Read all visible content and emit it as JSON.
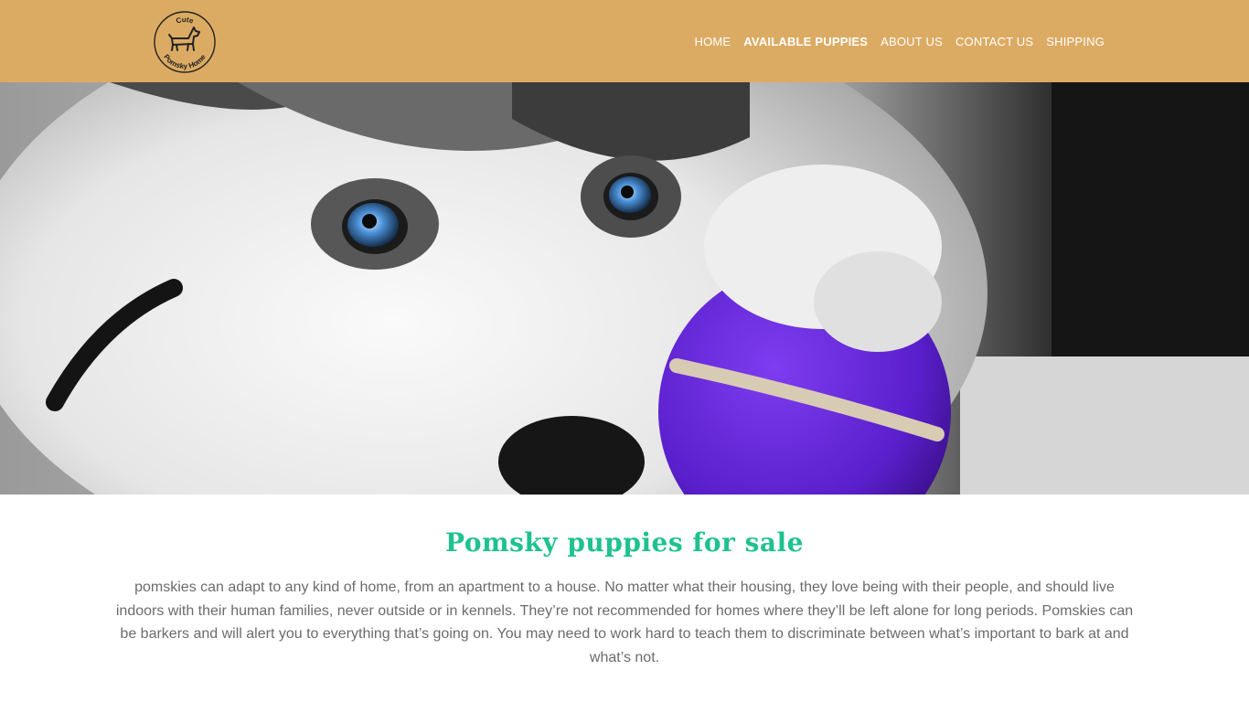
{
  "header": {
    "logo": {
      "top_text": "Cute",
      "bottom_text": "Pomsky Home",
      "icon": "dog-icon"
    },
    "nav": [
      {
        "label": "HOME",
        "active": false
      },
      {
        "label": "AVAILABLE PUPPIES",
        "active": true
      },
      {
        "label": "ABOUT US",
        "active": false
      },
      {
        "label": "CONTACT US",
        "active": false
      },
      {
        "label": "SHIPPING",
        "active": false
      }
    ],
    "background": "#dcab63"
  },
  "hero": {
    "subject": "pomsky-puppy-with-purple-ball"
  },
  "main": {
    "title": "Pomsky puppies for sale",
    "paragraph": "pomskies can adapt to any kind of home, from an apartment to a house. No matter what their housing, they love being with their people, and should live indoors with their human families, never outside or in kennels. They’re not recommended for homes where they’ll be left alone for long periods. Pomskies can be barkers and will alert you to everything that’s going on. You may need to work hard to teach them to discriminate between what’s important to bark at and what’s not."
  },
  "colors": {
    "accent": "#1ec28e",
    "header": "#dcab63",
    "text": "#6b6b6b"
  }
}
